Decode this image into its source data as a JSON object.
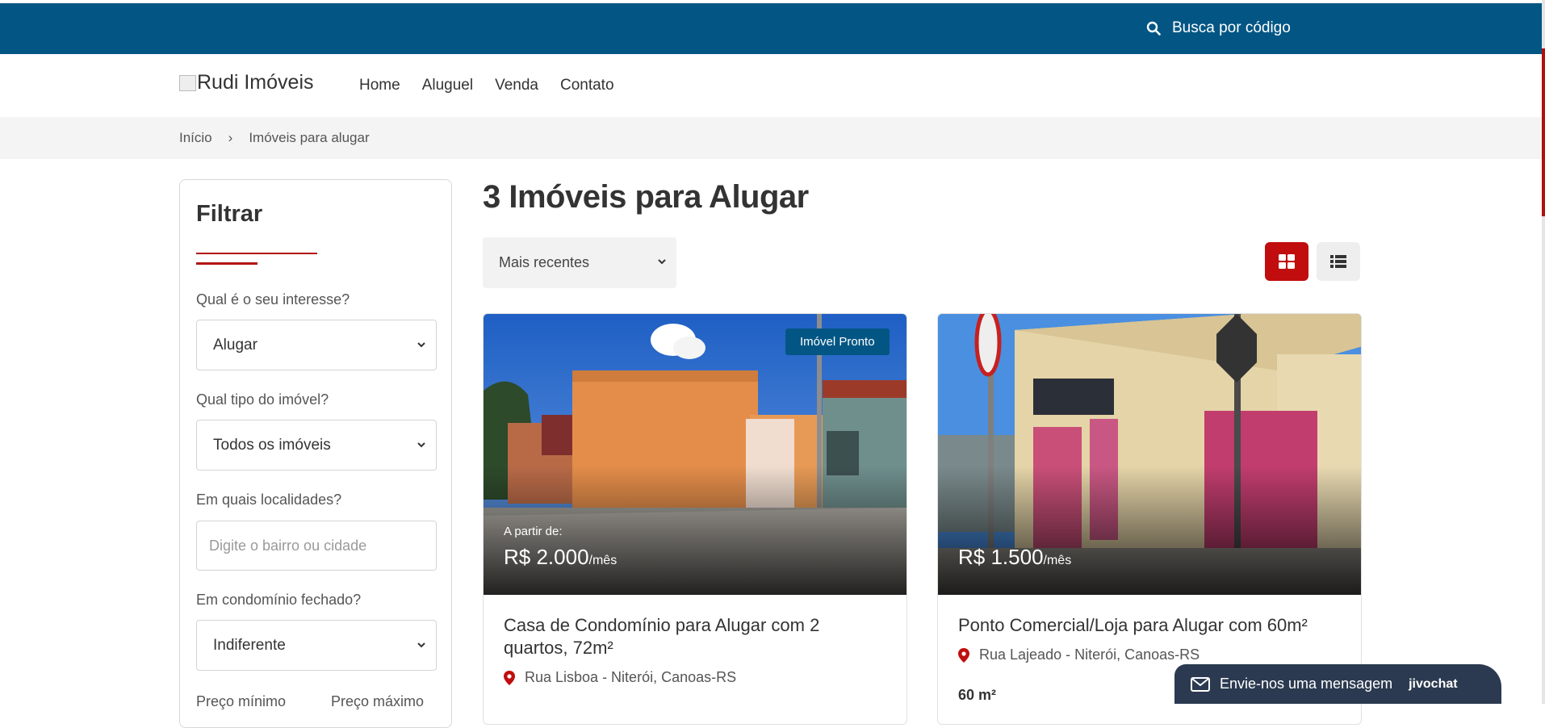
{
  "topbar": {
    "search_label": "Busca por código"
  },
  "header": {
    "logo_alt": "Rudi Imóveis",
    "nav": [
      "Home",
      "Aluguel",
      "Venda",
      "Contato"
    ]
  },
  "breadcrumb": {
    "home": "Início",
    "separator": "›",
    "current": "Imóveis para alugar"
  },
  "filter": {
    "title": "Filtrar",
    "interest_label": "Qual é o seu interesse?",
    "interest_value": "Alugar",
    "type_label": "Qual tipo do imóvel?",
    "type_value": "Todos os imóveis",
    "location_label": "Em quais localidades?",
    "location_placeholder": "Digite o bairro ou cidade",
    "condo_label": "Em condomínio fechado?",
    "condo_value": "Indiferente",
    "price_min_label": "Preço mínimo",
    "price_max_label": "Preço máximo"
  },
  "results": {
    "title": "3 Imóveis para Alugar",
    "sort_value": "Mais recentes"
  },
  "listings": [
    {
      "badge": "Imóvel Pronto",
      "from_label": "A partir de:",
      "price": "R$ 2.000",
      "period": "/mês",
      "title": "Casa de Condomínio para Alugar com 2 quartos, 72m²",
      "location": "Rua Lisboa - Niterói, Canoas-RS"
    },
    {
      "price": "R$ 1.500",
      "period": "/mês",
      "title": "Ponto Comercial/Loja para Alugar com 60m²",
      "location": "Rua Lajeado - Niterói, Canoas-RS",
      "area": "60 m²"
    }
  ],
  "chat": {
    "label": "Envie-nos uma mensagem",
    "brand": "jivochat"
  },
  "colors": {
    "topbar": "#035684",
    "accent": "#c10d0d",
    "badge": "#035684"
  },
  "icons": [
    "search-icon",
    "grid-view-icon",
    "list-view-icon",
    "map-pin-icon",
    "mail-icon",
    "chevron-down-icon"
  ]
}
